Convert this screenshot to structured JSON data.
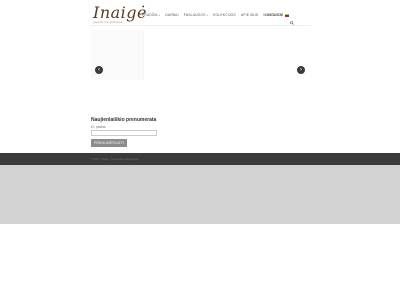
{
  "brand": {
    "name": "Inaigė",
    "tagline": "juvelyrinė dirbtuvė"
  },
  "nav": {
    "items": [
      {
        "label": "PRADŽIA",
        "caret": "▾"
      },
      {
        "label": "DARBAI"
      },
      {
        "label": "PASLAUGOS",
        "caret": "▾"
      },
      {
        "label": "KOLEKCIJOS"
      },
      {
        "label": "APIE MUS"
      },
      {
        "label": "KONTAKTAI"
      }
    ],
    "language": {
      "label": "LANGUAGE",
      "flag_colors": [
        "#fdb913",
        "#006a44",
        "#c1272d"
      ]
    },
    "search_icon": "search-icon"
  },
  "slider": {
    "prev_symbol": "‹",
    "next_symbol": "›"
  },
  "newsletter": {
    "title": "Naujienlaiškio prenumerata",
    "email_label": "El. paštas",
    "email_value": "",
    "button_label": "PRENUMERUOTI"
  },
  "footer": {
    "text": "© 2017 Inaigė. Visos teisės saugomos"
  },
  "colors": {
    "brand": "#5a3a22",
    "footer_bg": "#3b3b3b",
    "below_bg": "#d2d2d2",
    "button_bg": "#8c8c8c"
  }
}
